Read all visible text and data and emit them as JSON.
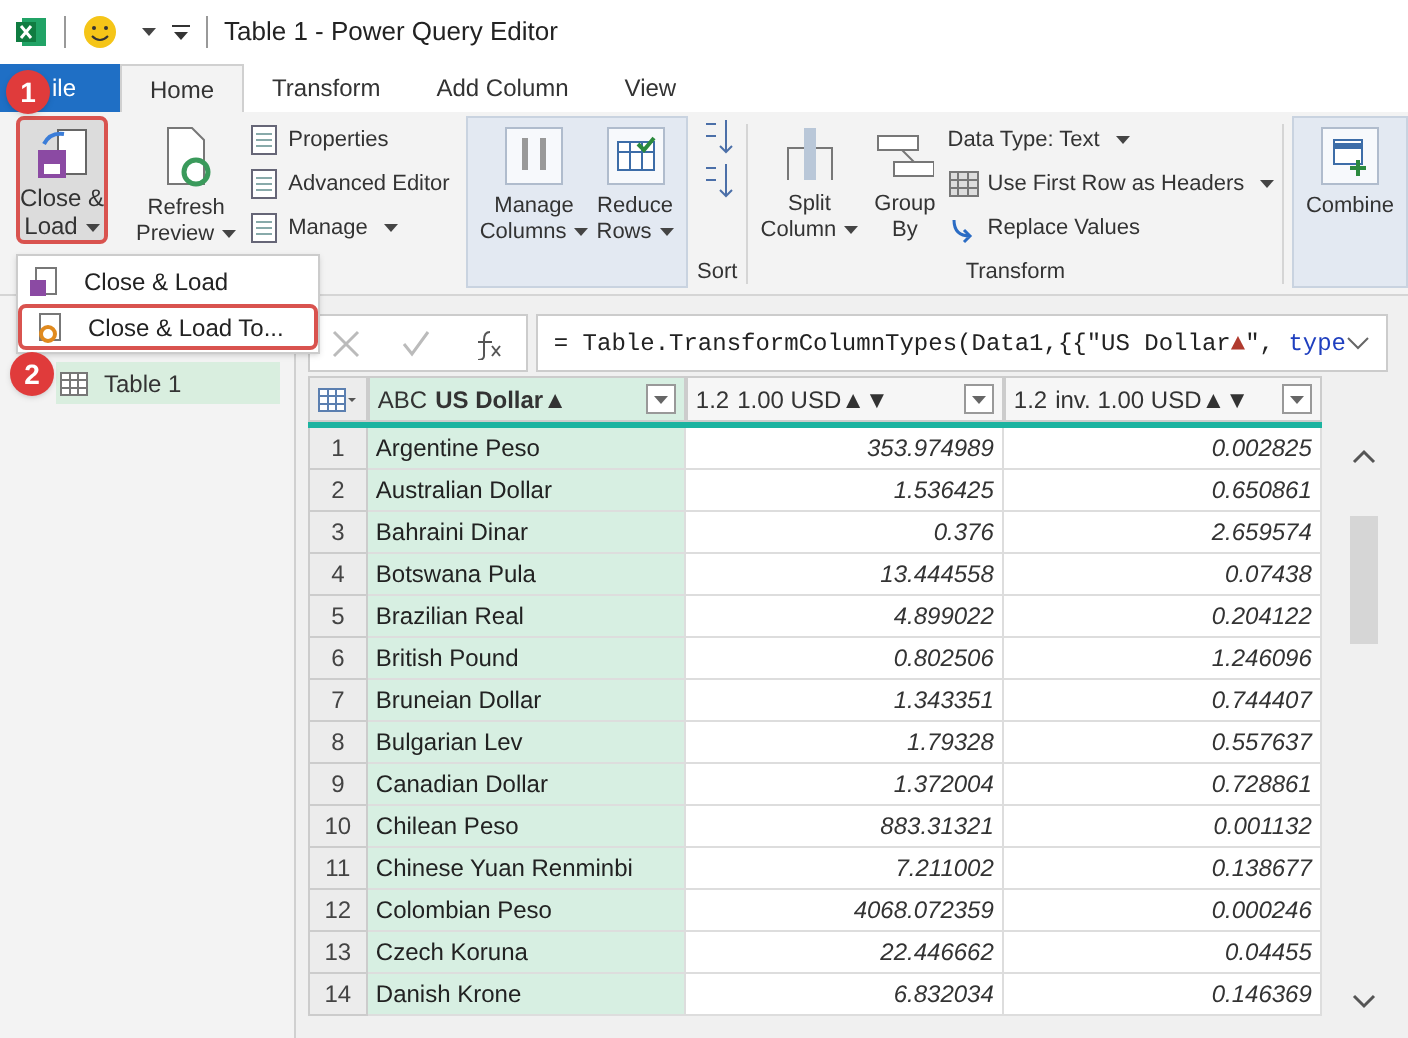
{
  "window": {
    "title": "Table 1 - Power Query Editor"
  },
  "tabs": [
    {
      "label": "ile",
      "selected": false,
      "kind": "file"
    },
    {
      "label": "Home",
      "selected": true,
      "kind": "tab"
    },
    {
      "label": "Transform",
      "selected": false,
      "kind": "tab"
    },
    {
      "label": "Add Column",
      "selected": false,
      "kind": "tab"
    },
    {
      "label": "View",
      "selected": false,
      "kind": "tab"
    }
  ],
  "ribbon": {
    "close_load": "Close &",
    "close_load_2": "Load",
    "refresh": [
      "Refresh",
      "Preview"
    ],
    "query_items": [
      "Properties",
      "Advanced Editor",
      "Manage"
    ],
    "manage_columns": [
      "Manage",
      "Columns"
    ],
    "reduce_rows": [
      "Reduce",
      "Rows"
    ],
    "sort_label": "Sort",
    "split": [
      "Split",
      "Column"
    ],
    "group_by": [
      "Group",
      "By"
    ],
    "transform_items": [
      "Data Type: Text",
      "Use First Row as Headers",
      "Replace Values"
    ],
    "transform_label": "Transform",
    "combine": "Combine"
  },
  "menu": [
    {
      "label": "Close & Load",
      "selected": false
    },
    {
      "label": "Close & Load To...",
      "selected": true
    }
  ],
  "badges": [
    "1",
    "2"
  ],
  "queries": [
    {
      "label": "Table 1",
      "selected": true
    }
  ],
  "formula": [
    {
      "text": "= Table.TransformColumnTypes(Data1,{{\"US Dollar",
      "kind": "plain"
    },
    {
      "text": "▲",
      "kind": "mark"
    },
    {
      "text": "\", ",
      "kind": "plain"
    },
    {
      "text": "type",
      "kind": "keyword"
    }
  ],
  "row_numbers": [
    "1",
    "2",
    "3",
    "4",
    "5",
    "6",
    "7",
    "8",
    "9",
    "10",
    "11",
    "12",
    "13",
    "14"
  ],
  "table": {
    "columns": [
      {
        "type": "ABC",
        "label": "US Dollar▲",
        "selected": true
      },
      {
        "type": "1.2",
        "label": "1.00 USD▲▼",
        "selected": false
      },
      {
        "type": "1.2",
        "label": "inv. 1.00 USD▲▼",
        "selected": false
      }
    ],
    "rows": [
      [
        "Argentine Peso",
        "353.974989",
        "0.002825"
      ],
      [
        "Australian Dollar",
        "1.536425",
        "0.650861"
      ],
      [
        "Bahraini Dinar",
        "0.376",
        "2.659574"
      ],
      [
        "Botswana Pula",
        "13.444558",
        "0.07438"
      ],
      [
        "Brazilian Real",
        "4.899022",
        "0.204122"
      ],
      [
        "British Pound",
        "0.802506",
        "1.246096"
      ],
      [
        "Bruneian Dollar",
        "1.343351",
        "0.744407"
      ],
      [
        "Bulgarian Lev",
        "1.79328",
        "0.557637"
      ],
      [
        "Canadian Dollar",
        "1.372004",
        "0.728861"
      ],
      [
        "Chilean Peso",
        "883.31321",
        "0.001132"
      ],
      [
        "Chinese Yuan Renminbi",
        "7.211002",
        "0.138677"
      ],
      [
        "Colombian Peso",
        "4068.072359",
        "0.000246"
      ],
      [
        "Czech Koruna",
        "22.446662",
        "0.04455"
      ],
      [
        "Danish Krone",
        "6.832034",
        "0.146369"
      ]
    ]
  }
}
